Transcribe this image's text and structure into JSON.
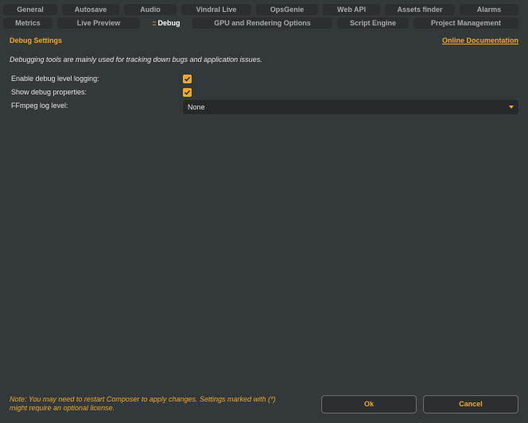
{
  "tabs_row1": [
    {
      "label": "General"
    },
    {
      "label": "Autosave"
    },
    {
      "label": "Audio"
    },
    {
      "label": "Vindral Live"
    },
    {
      "label": "OpsGenie"
    },
    {
      "label": "Web API"
    },
    {
      "label": "Assets finder"
    },
    {
      "label": "Alarms"
    }
  ],
  "tabs_row2": [
    {
      "label": "Metrics"
    },
    {
      "label": "Live Preview"
    },
    {
      "label": "Debug",
      "active": true,
      "grip": "::"
    },
    {
      "label": "GPU and Rendering Options"
    },
    {
      "label": "Script Engine"
    },
    {
      "label": "Project Management"
    }
  ],
  "section": {
    "title": "Debug Settings",
    "doc_link": "Online Documentation",
    "description": "Debugging tools are mainly used for tracking down bugs and application issues."
  },
  "settings": {
    "debug_logging": {
      "label": "Enable debug level logging:",
      "checked": true
    },
    "debug_properties": {
      "label": "Show debug properties:",
      "checked": true
    },
    "ffmpeg_log_level": {
      "label": "FFmpeg log level:",
      "value": "None"
    }
  },
  "footer": {
    "note_line1": "Note: You may need to restart Composer to apply changes. Settings marked with (*)",
    "note_line2": "might require an optional license.",
    "ok_label": "Ok",
    "cancel_label": "Cancel"
  },
  "colors": {
    "accent": "#f0a92d",
    "background": "#33383b",
    "tab_background": "#2b2f31"
  }
}
